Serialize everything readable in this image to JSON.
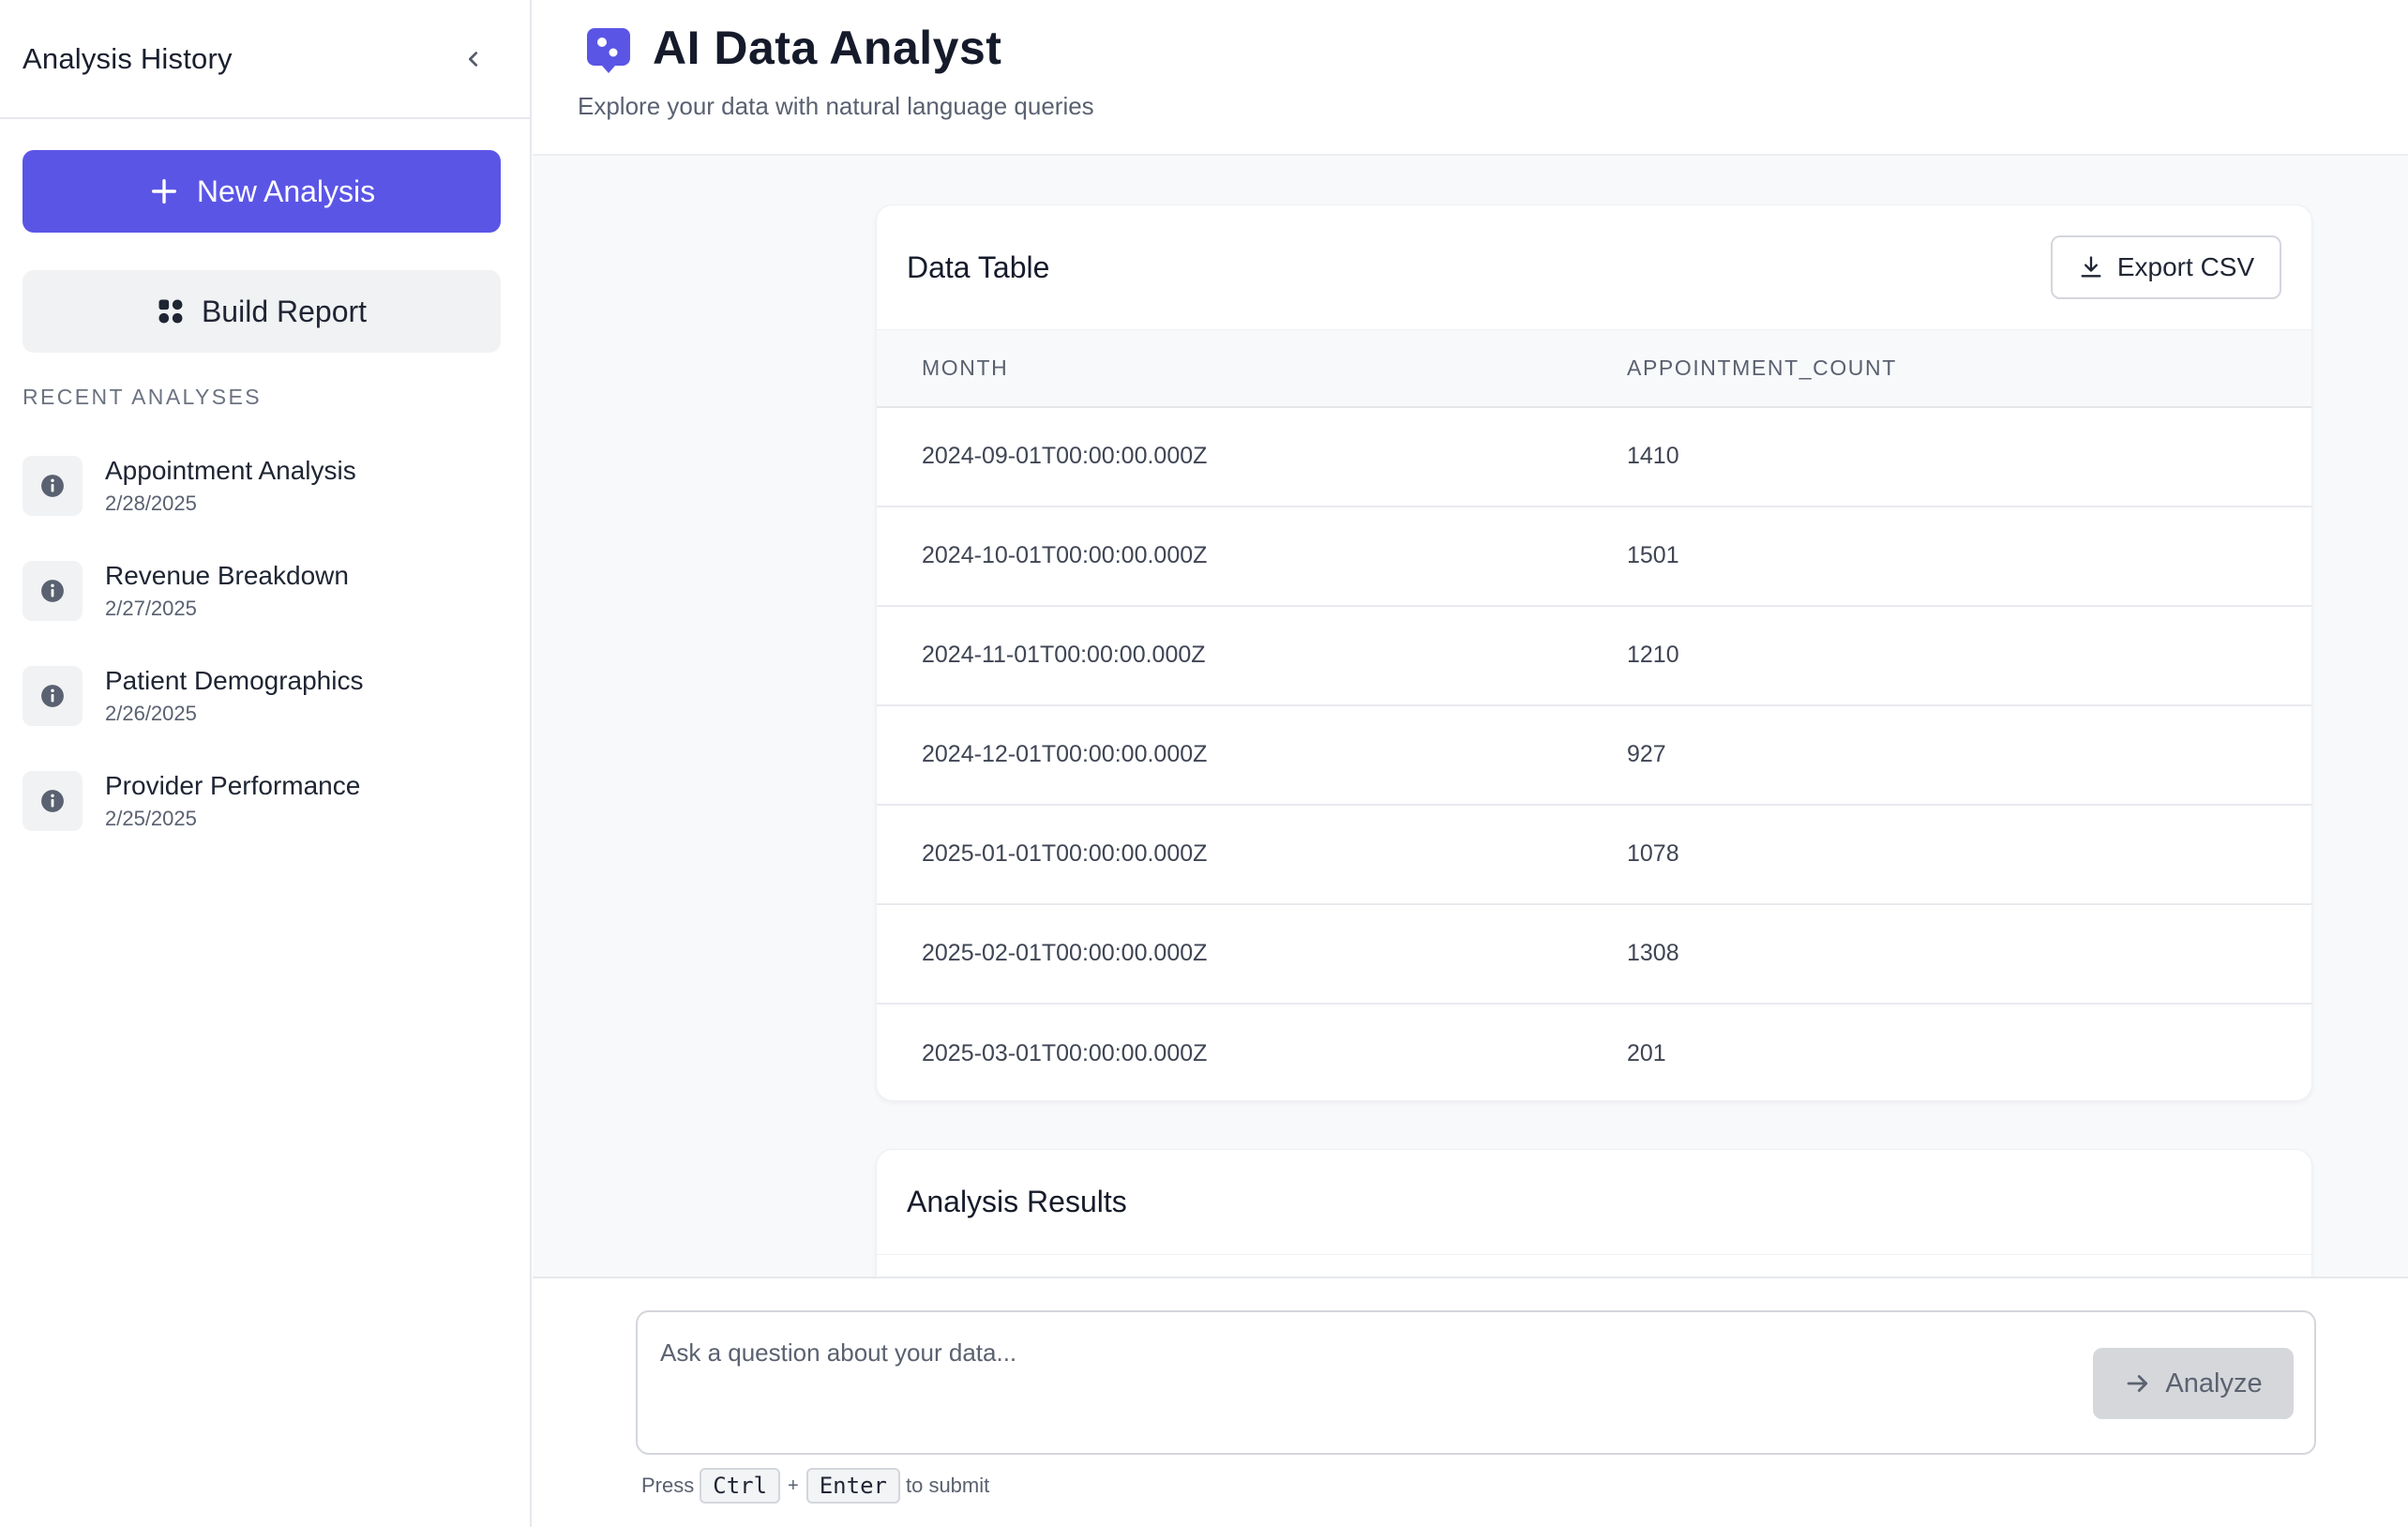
{
  "sidebar": {
    "title": "Analysis History",
    "new_analysis_label": "New Analysis",
    "build_report_label": "Build Report",
    "recent_heading": "RECENT ANALYSES",
    "recent": [
      {
        "name": "Appointment Analysis",
        "date": "2/28/2025"
      },
      {
        "name": "Revenue Breakdown",
        "date": "2/27/2025"
      },
      {
        "name": "Patient Demographics",
        "date": "2/26/2025"
      },
      {
        "name": "Provider Performance",
        "date": "2/25/2025"
      }
    ]
  },
  "header": {
    "title": "AI Data Analyst",
    "subtitle": "Explore your data with natural language queries"
  },
  "data_table": {
    "title": "Data Table",
    "export_label": "Export CSV",
    "columns": [
      "MONTH",
      "APPOINTMENT_COUNT"
    ],
    "rows": [
      [
        "2024-09-01T00:00:00.000Z",
        "1410"
      ],
      [
        "2024-10-01T00:00:00.000Z",
        "1501"
      ],
      [
        "2024-11-01T00:00:00.000Z",
        "1210"
      ],
      [
        "2024-12-01T00:00:00.000Z",
        "927"
      ],
      [
        "2025-01-01T00:00:00.000Z",
        "1078"
      ],
      [
        "2025-02-01T00:00:00.000Z",
        "1308"
      ],
      [
        "2025-03-01T00:00:00.000Z",
        "201"
      ]
    ]
  },
  "results": {
    "title": "Analysis Results"
  },
  "composer": {
    "placeholder": "Ask a question about your data...",
    "value": "",
    "analyze_label": "Analyze",
    "hint_press": "Press",
    "hint_key1": "Ctrl",
    "hint_plus": "+",
    "hint_key2": "Enter",
    "hint_suffix": "to submit"
  },
  "colors": {
    "accent": "#5b55e6",
    "button_disabled": "#d5d7db"
  },
  "icons": {
    "collapse": "chevron-left-icon",
    "new": "plus-icon",
    "report": "grid-icon",
    "recent": "info-icon",
    "export": "download-icon",
    "analyze": "arrow-right-icon",
    "logo": "chat-logo-icon"
  }
}
